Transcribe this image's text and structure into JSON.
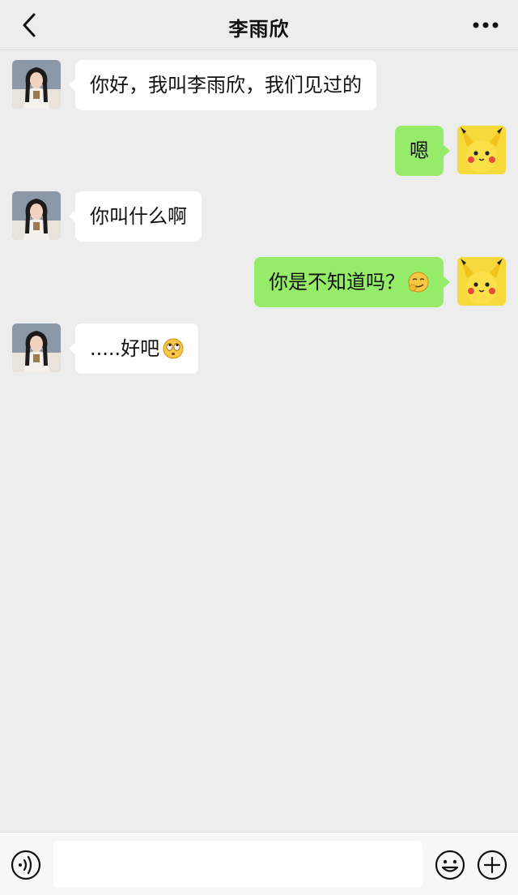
{
  "header": {
    "title": "李雨欣",
    "back_icon": "chevron-left-icon",
    "more_icon": "more-dots-icon"
  },
  "messages": [
    {
      "side": "in",
      "text": "你好，我叫李雨欣，我们见过的",
      "avatar": "contact-avatar"
    },
    {
      "side": "out",
      "text": "嗯",
      "avatar": "pikachu-avatar"
    },
    {
      "side": "in",
      "text": "你叫什么啊",
      "avatar": "contact-avatar"
    },
    {
      "side": "out",
      "text": "你是不知道吗？",
      "emoji": "smirk-emoji",
      "avatar": "pikachu-avatar"
    },
    {
      "side": "in",
      "text": ".....好吧",
      "emoji": "rolling-eyes-emoji",
      "avatar": "contact-avatar"
    }
  ],
  "input_bar": {
    "text": "",
    "voice_icon": "voice-icon",
    "emoji_icon": "smiley-icon",
    "plus_icon": "plus-circle-icon"
  },
  "colors": {
    "background": "#ededed",
    "bubble_in": "#ffffff",
    "bubble_out": "#95ec69",
    "pikachu_yellow": "#f6d93b"
  }
}
